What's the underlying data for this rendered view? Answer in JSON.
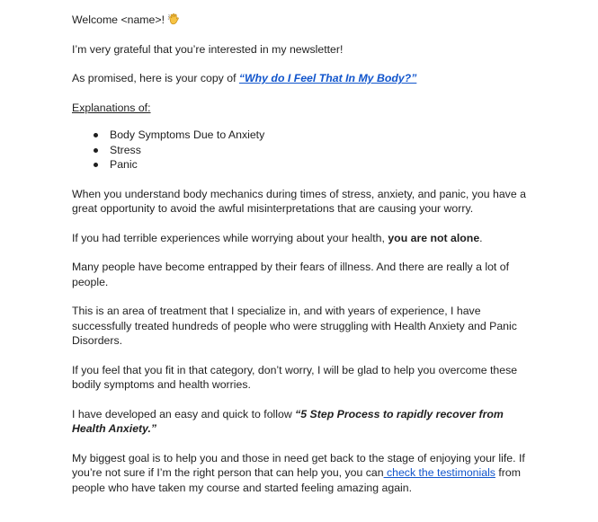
{
  "greeting": {
    "text": "Welcome <name>!",
    "emoji_icon": "waving-hand-icon"
  },
  "gratitude": "I’m very grateful that you’re interested in my newsletter!",
  "promise": {
    "prefix": "As promised, here is your copy of ",
    "link_text": "“Why do I  Feel That In My Body?”"
  },
  "explanations": {
    "heading": "Explanations of:",
    "items": [
      "Body Symptoms Due to Anxiety",
      "Stress",
      "Panic"
    ]
  },
  "paragraphs": {
    "mechanics": "When you understand body mechanics during times of stress, anxiety, and panic, you have a great opportunity to avoid the awful misinterpretations that are causing your worry.",
    "not_alone_prefix": "If you had terrible experiences while worrying about your health, ",
    "not_alone_bold": "you are not alone",
    "not_alone_suffix": ".",
    "entrapped": "Many people have become entrapped by their fears of illness. And there are really a lot of people.",
    "specialize": "This is an area of treatment that I specialize in, and with years of experience, I have successfully treated hundreds of people who were struggling with Health Anxiety and Panic Disorders.",
    "fit_in": "If you feel that you fit in that category, don’t worry, I will be glad to help you overcome these bodily symptoms and health worries.",
    "process_prefix": "I have developed an easy and quick to follow ",
    "process_bold": "“5 Step Process to rapidly recover from Health Anxiety.”",
    "goal_prefix": "My biggest goal is to help you and those in need get back to the stage of enjoying your life. If you’re not sure if I’m the right person that can help you, you can",
    "goal_link": " check the testimonials",
    "goal_suffix": " from people who have taken my course and started feeling amazing again."
  },
  "colors": {
    "text": "#1f1f1f",
    "link": "#1155cc",
    "background": "#ffffff"
  }
}
